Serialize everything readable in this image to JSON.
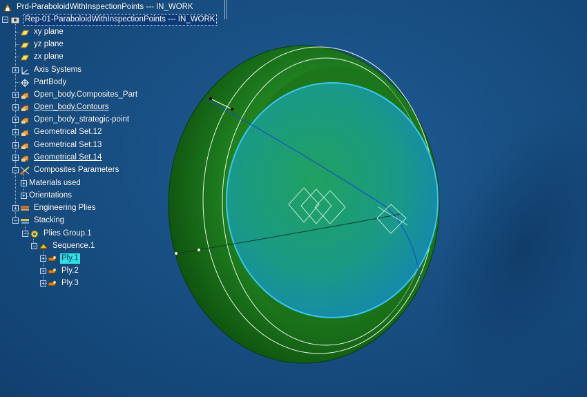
{
  "tree": {
    "root_title": "Prd-ParaboloidWithInspectionPoints --- IN_WORK",
    "rep_title": "Rep-01-ParaboloidWithInspectionPoints --- IN_WORK",
    "nodes": [
      {
        "label": "xy plane",
        "icon": "plane-icon"
      },
      {
        "label": "yz plane",
        "icon": "plane-icon"
      },
      {
        "label": "zx plane",
        "icon": "plane-icon"
      },
      {
        "label": "Axis Systems",
        "icon": "axis-system-icon"
      },
      {
        "label": "PartBody",
        "icon": "partbody-icon"
      },
      {
        "label": "Open_body.Composites_Part",
        "icon": "geometrical-set-icon"
      },
      {
        "label": "Open_body.Contours",
        "icon": "geometrical-set-icon"
      },
      {
        "label": "Open_body_strategic-point",
        "icon": "geometrical-set-icon"
      },
      {
        "label": "Geometrical Set.12",
        "icon": "geometrical-set-icon"
      },
      {
        "label": "Geometrical Set.13",
        "icon": "geometrical-set-icon"
      },
      {
        "label": "Geometrical Set.14",
        "icon": "geometrical-set-icon"
      },
      {
        "label": "Composites Parameters",
        "icon": "composites-parameters-icon"
      },
      {
        "label": "Materials used",
        "icon": ""
      },
      {
        "label": "Orientations",
        "icon": ""
      },
      {
        "label": "Engineering Plies",
        "icon": "engineering-plies-icon"
      },
      {
        "label": "Stacking",
        "icon": "stacking-icon"
      },
      {
        "label": "Plies Group.1",
        "icon": "plies-group-icon"
      },
      {
        "label": "Sequence.1",
        "icon": "sequence-icon"
      },
      {
        "label": "Ply.1",
        "icon": "ply-icon"
      },
      {
        "label": "Ply.2",
        "icon": "ply-icon"
      },
      {
        "label": "Ply.3",
        "icon": "ply-icon"
      }
    ]
  },
  "colors": {
    "background": "#184f83",
    "shell_outer": "#1e7a1e",
    "shell_inner": "#2aa06a",
    "highlight_edge": "#38c8f0",
    "selection_cyan": "#33e0e0"
  }
}
